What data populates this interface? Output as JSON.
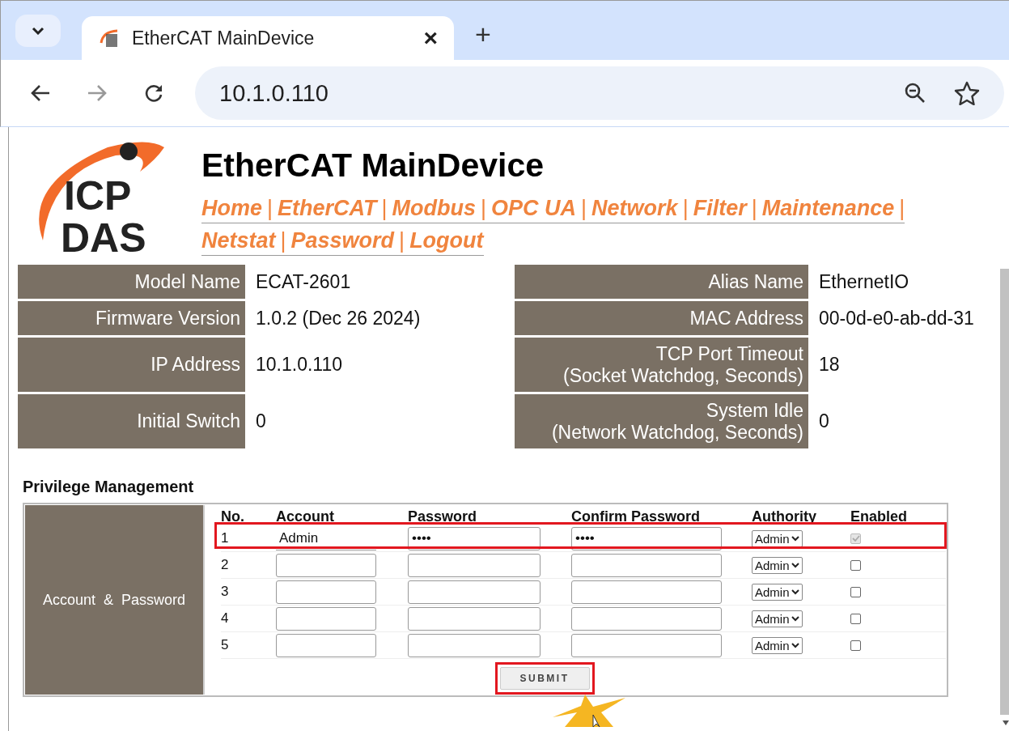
{
  "browser": {
    "tab": {
      "title": "EtherCAT MainDevice",
      "selected": true
    },
    "new_tab": "+",
    "close": "×",
    "address": "10.1.0.110"
  },
  "header": {
    "logo": [
      "ICP",
      "DAS"
    ],
    "title": "EtherCAT MainDevice",
    "separator": "|",
    "nav": [
      [
        "Home",
        "EtherCAT",
        "Modbus",
        "OPC UA",
        "Network",
        "Filter",
        "Maintenance"
      ],
      [
        "Netstat",
        "Password",
        "Logout"
      ]
    ]
  },
  "info": [
    [
      {
        "label": [
          "Model Name"
        ],
        "value": "ECAT-2601"
      },
      {
        "label": [
          "Alias Name"
        ],
        "value": "EthernetIO"
      }
    ],
    [
      {
        "label": [
          "Firmware Version"
        ],
        "value": "1.0.2 (Dec 26 2024)"
      },
      {
        "label": [
          "MAC Address"
        ],
        "value": "00-0d-e0-ab-dd-31"
      }
    ],
    [
      {
        "label": [
          "IP Address"
        ],
        "value": "10.1.0.110"
      },
      {
        "label": [
          "TCP Port Timeout",
          "(Socket Watchdog, Seconds)"
        ],
        "value": "18"
      }
    ],
    [
      {
        "label": [
          "Initial Switch"
        ],
        "value": "0"
      },
      {
        "label": [
          "System Idle",
          "(Network Watchdog, Seconds)"
        ],
        "value": "0"
      }
    ]
  ],
  "privilege": {
    "title": "Privilege Management",
    "side_label": "Account  &  Password",
    "columns": [
      "No.",
      "Account",
      "Password",
      "Confirm Password",
      "Authority",
      "Enabled"
    ],
    "rows": [
      {
        "no": "1",
        "account": "Admin",
        "password": "••••",
        "confirm": "••••",
        "authority": "Admin",
        "enabled": true,
        "disabled": true,
        "highlighted": true
      },
      {
        "no": "2",
        "account": "",
        "password": "",
        "confirm": "",
        "authority": "Admin",
        "enabled": false,
        "disabled": false,
        "highlighted": false
      },
      {
        "no": "3",
        "account": "",
        "password": "",
        "confirm": "",
        "authority": "Admin",
        "enabled": false,
        "disabled": false,
        "highlighted": false
      },
      {
        "no": "4",
        "account": "",
        "password": "",
        "confirm": "",
        "authority": "Admin",
        "enabled": false,
        "disabled": false,
        "highlighted": false
      },
      {
        "no": "5",
        "account": "",
        "password": "",
        "confirm": "",
        "authority": "Admin",
        "enabled": false,
        "disabled": false,
        "highlighted": false
      }
    ],
    "submit": {
      "label": "SUBMIT",
      "highlighted": true
    }
  }
}
